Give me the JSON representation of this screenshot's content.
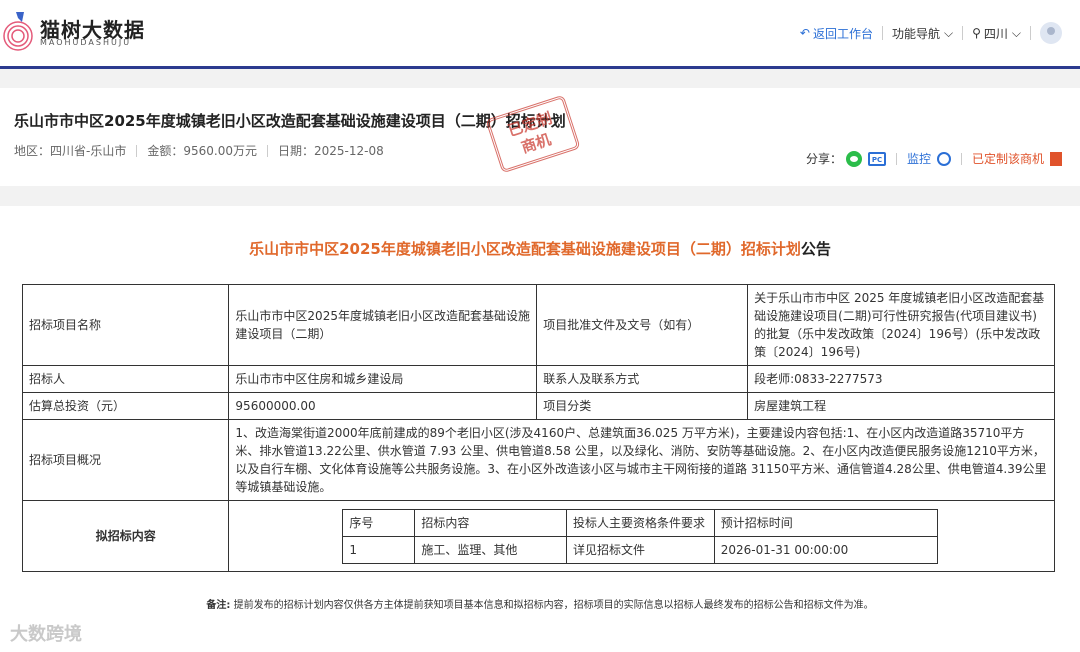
{
  "brand": {
    "name": "猫树大数据",
    "sub": "MAOHUDASHUJU"
  },
  "nav": {
    "back": "返回工作台",
    "menu": "功能导航",
    "region": "四川"
  },
  "project": {
    "title": "乐山市市中区2025年度城镇老旧小区改造配套基础设施建设项目（二期）招标计划",
    "region_label": "地区：",
    "region": "四川省-乐山市",
    "amount_label": "金额：",
    "amount": "9560.00万元",
    "date_label": "日期：",
    "date": "2025-12-08",
    "stamp_line1": "已定制",
    "stamp_line2": "商机"
  },
  "share": {
    "label": "分享：",
    "pc": "PC",
    "monitor": "监控",
    "subscribed": "已定制该商机"
  },
  "announcement": {
    "title_main": "乐山市市中区2025年度城镇老旧小区改造配套基础设施建设项目（二期）招标计划",
    "title_suffix": "公告"
  },
  "table": {
    "r1_label": "招标项目名称",
    "r1_value": "乐山市市中区2025年度城镇老旧小区改造配套基础设施建设项目（二期）",
    "r1_label2": "项目批准文件及文号（如有）",
    "r1_value2": "关于乐山市市中区 2025 年度城镇老旧小区改造配套基础设施建设项目(二期)可行性研究报告(代项目建议书)的批复（乐中发改政策〔2024〕196号）(乐中发改政策〔2024〕196号)",
    "r2_label": "招标人",
    "r2_value": "乐山市市中区住房和城乡建设局",
    "r2_label2": "联系人及联系方式",
    "r2_value2": "段老师:0833-2277573",
    "r3_label": "估算总投资（元）",
    "r3_value": "95600000.00",
    "r3_label2": "项目分类",
    "r3_value2": "房屋建筑工程",
    "r4_label": "招标项目概况",
    "r4_value": "1、改造海棠街道2000年底前建成的89个老旧小区(涉及4160户、总建筑面36.025 万平方米)，主要建设内容包括:1、在小区内改造道路35710平方米、排水管道13.22公里、供水管道 7.93 公里、供电管道8.58 公里，以及绿化、消防、安防等基础设施。2、在小区内改造便民服务设施1210平方米，以及自行车棚、文化体育设施等公共服务设施。3、在小区外改造该小区与城市主干网衔接的道路 31150平方米、通信管道4.28公里、供电管道4.39公里等城镇基础设施。",
    "r5_label": "拟招标内容",
    "inner_headers": [
      "序号",
      "招标内容",
      "投标人主要资格条件要求",
      "预计招标时间"
    ],
    "inner_rows": [
      [
        "1",
        "施工、监理、其他",
        "详见招标文件",
        "2026-01-31 00:00:00"
      ]
    ]
  },
  "note": {
    "label": "备注:",
    "text": "提前发布的招标计划内容仅供各方主体提前获知项目基本信息和拟招标内容，招标项目的实际信息以招标人最终发布的招标公告和招标文件为准。"
  },
  "watermark": "大数跨境",
  "colors": {
    "accent_blue": "#2b6fd6",
    "header_bar": "#2b3a8f",
    "title_orange": "#e0682b",
    "stamp_red": "#c9362c"
  }
}
